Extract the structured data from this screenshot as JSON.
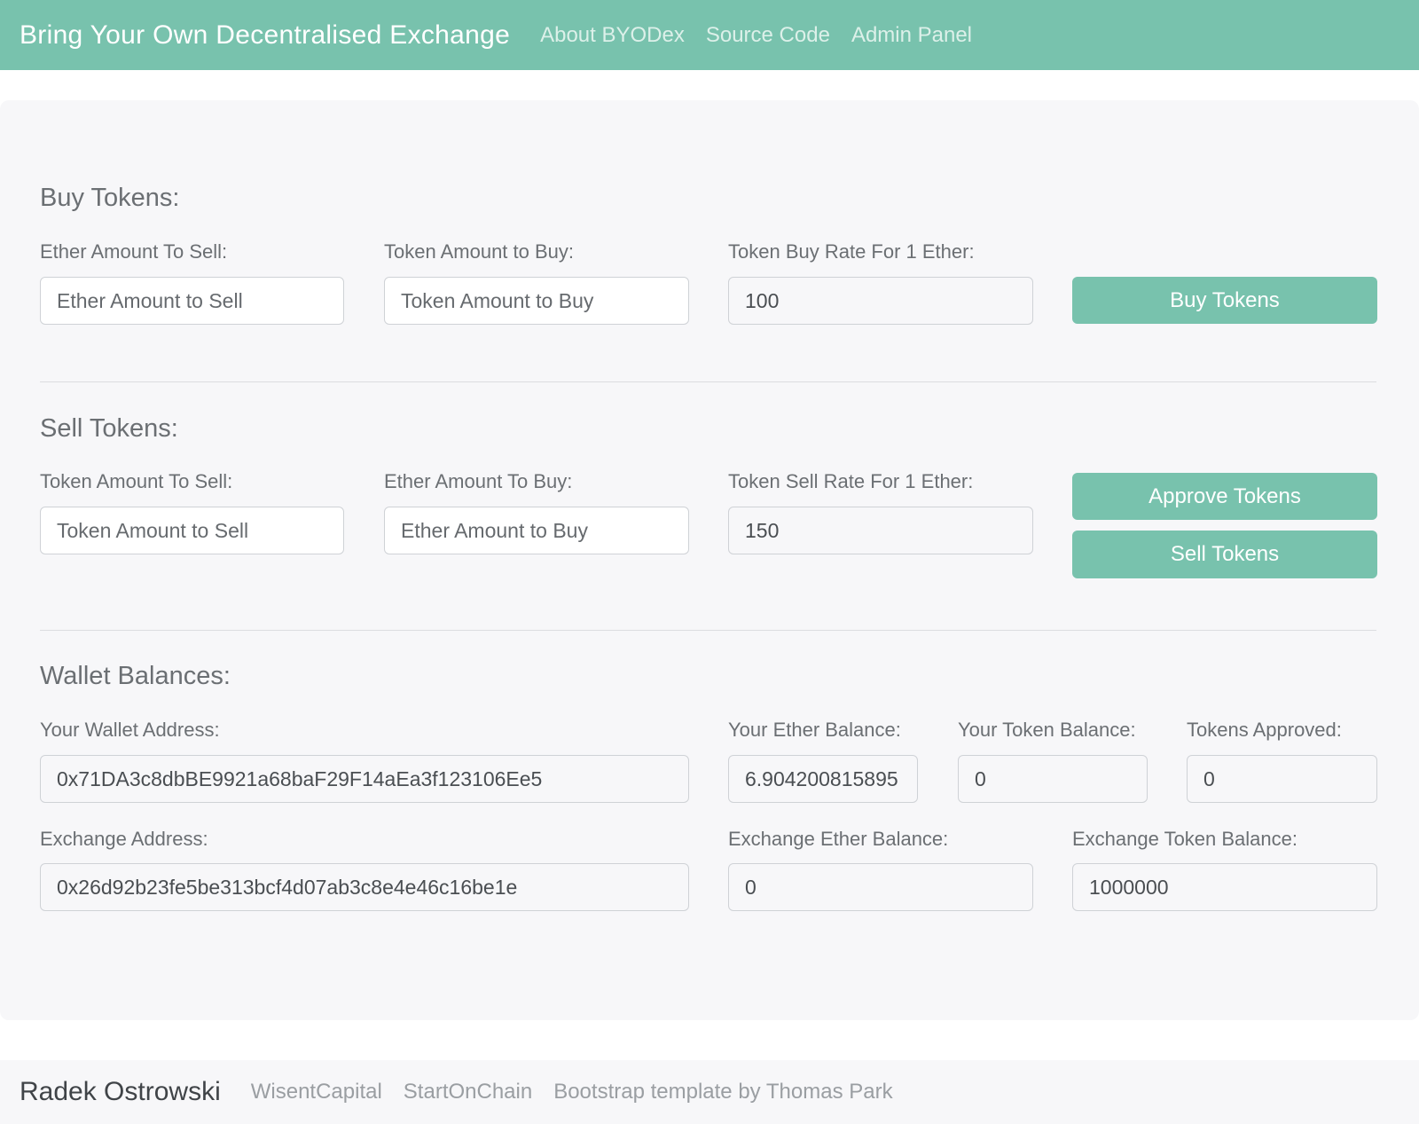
{
  "navbar": {
    "brand": "Bring Your Own Decentralised Exchange",
    "links": [
      "About BYODex",
      "Source Code",
      "Admin Panel"
    ]
  },
  "buy": {
    "title": "Buy Tokens:",
    "ether_label": "Ether Amount To Sell:",
    "ether_placeholder": "Ether Amount to Sell",
    "token_label": "Token Amount to Buy:",
    "token_placeholder": "Token Amount to Buy",
    "rate_label": "Token Buy Rate For 1 Ether:",
    "rate_value": "100",
    "button": "Buy Tokens"
  },
  "sell": {
    "title": "Sell Tokens:",
    "token_label": "Token Amount To Sell:",
    "token_placeholder": "Token Amount to Sell",
    "ether_label": "Ether Amount To Buy:",
    "ether_placeholder": "Ether Amount to Buy",
    "rate_label": "Token Sell Rate For 1 Ether:",
    "rate_value": "150",
    "approve_button": "Approve Tokens",
    "sell_button": "Sell Tokens"
  },
  "wallet": {
    "title": "Wallet Balances:",
    "address_label": "Your Wallet Address:",
    "address_value": "0x71DA3c8dbBE9921a68baF29F14aEa3f123106Ee5",
    "ether_balance_label": "Your Ether Balance:",
    "ether_balance_value": "6.904200815895",
    "token_balance_label": "Your Token Balance:",
    "token_balance_value": "0",
    "approved_label": "Tokens Approved:",
    "approved_value": "0",
    "exchange_address_label": "Exchange Address:",
    "exchange_address_value": "0x26d92b23fe5be313bcf4d07ab3c8e4e46c16be1e",
    "exchange_ether_label": "Exchange Ether Balance:",
    "exchange_ether_value": "0",
    "exchange_token_label": "Exchange Token Balance:",
    "exchange_token_value": "1000000"
  },
  "footer": {
    "brand": "Radek Ostrowski",
    "links": [
      "WisentCapital",
      "StartOnChain",
      "Bootstrap template by Thomas Park"
    ]
  },
  "colors": {
    "accent": "#78c2ad",
    "panel": "#f7f7f9"
  }
}
